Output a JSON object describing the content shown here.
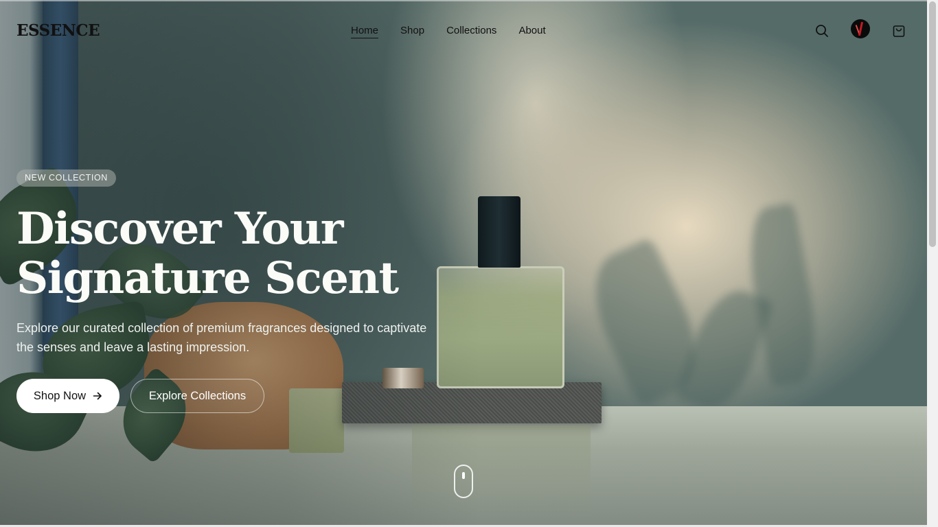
{
  "brand": {
    "logo_text": "ESSENCE"
  },
  "nav": {
    "items": [
      {
        "label": "Home",
        "active": true
      },
      {
        "label": "Shop",
        "active": false
      },
      {
        "label": "Collections",
        "active": false
      },
      {
        "label": "About",
        "active": false
      }
    ],
    "icons": {
      "search": "search-icon",
      "avatar": "user-avatar",
      "cart": "shopping-bag-icon"
    }
  },
  "hero": {
    "badge": "NEW COLLECTION",
    "headline_line1": "Discover Your",
    "headline_line2": "Signature Scent",
    "subtext": "Explore our curated collection of premium fragrances designed to captivate the senses and leave a lasting impression.",
    "primary_cta": "Shop Now",
    "primary_cta_icon": "arrow-right-icon",
    "secondary_cta": "Explore Collections"
  },
  "colors": {
    "headline": "#fbfbf7",
    "primary_button_bg": "#ffffff",
    "nav_text": "#111111"
  }
}
